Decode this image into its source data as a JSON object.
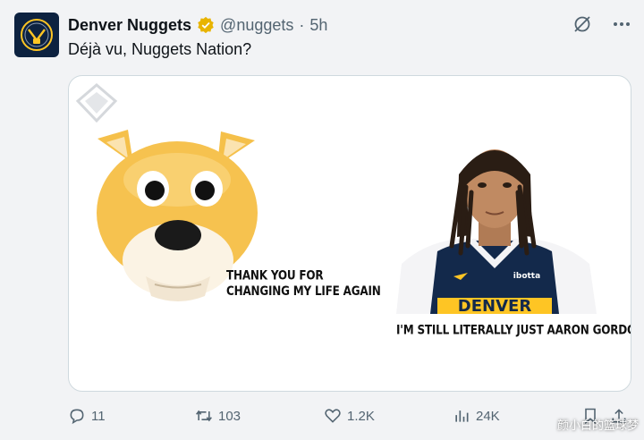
{
  "post": {
    "author_name": "Denver Nuggets",
    "handle": "@nuggets",
    "separator": "·",
    "time": "5h",
    "text": "Déjà vu, Nuggets Nation?"
  },
  "media": {
    "caption_left": "THANK YOU FOR\nCHANGING MY LIFE AGAIN",
    "caption_right": "I'M STILL LITERALLY JUST AARON GORDON",
    "jersey_text": "DENVER",
    "jersey_sponsor": "ibotta"
  },
  "actions": {
    "replies": "11",
    "reposts": "103",
    "likes": "1.2K",
    "views": "24K"
  },
  "watermark": "颜小白的篮球梦",
  "colors": {
    "verified": "#e8b400",
    "team_navy": "#0d2240",
    "team_gold": "#fec524"
  },
  "icons": [
    "verified-icon",
    "grok-icon",
    "more-icon",
    "reply-icon",
    "repost-icon",
    "like-icon",
    "views-icon",
    "bookmark-icon",
    "share-icon"
  ]
}
